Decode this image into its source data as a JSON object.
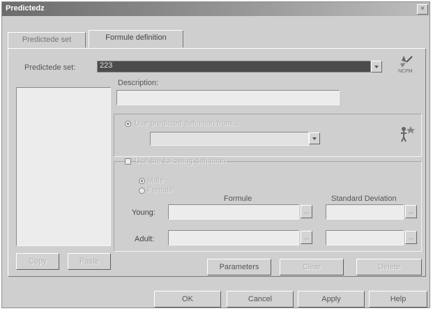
{
  "window": {
    "title": "Predictedz",
    "close_glyph": "×"
  },
  "tabs": [
    {
      "label": "Predictede set"
    },
    {
      "label": "Formule definition"
    }
  ],
  "set_row": {
    "label": "Predictede set:",
    "value": "223"
  },
  "description": {
    "label": "Description:",
    "value": ""
  },
  "option_a": {
    "label": "Use predicted definition from...",
    "dropdown_value": ""
  },
  "option_b": {
    "label": "Use the following definition..."
  },
  "sex": {
    "male_label": "Male",
    "female_label": "Female"
  },
  "columns": {
    "formula": "Formule",
    "std_dev": "Standard Deviation"
  },
  "rows": {
    "young_label": "Young:",
    "adult_label": "Adult:"
  },
  "left_buttons": {
    "copy": "Copy",
    "paste": "Paste"
  },
  "mid_buttons": {
    "parameters": "Parameters",
    "clear": "Clear",
    "delete": "Delete"
  },
  "footer": {
    "ok": "OK",
    "cancel": "Cancel",
    "apply": "Apply",
    "help": "Help"
  },
  "icons": {
    "top_right": "wizard-icon",
    "mid_right": "person-stars-icon"
  }
}
